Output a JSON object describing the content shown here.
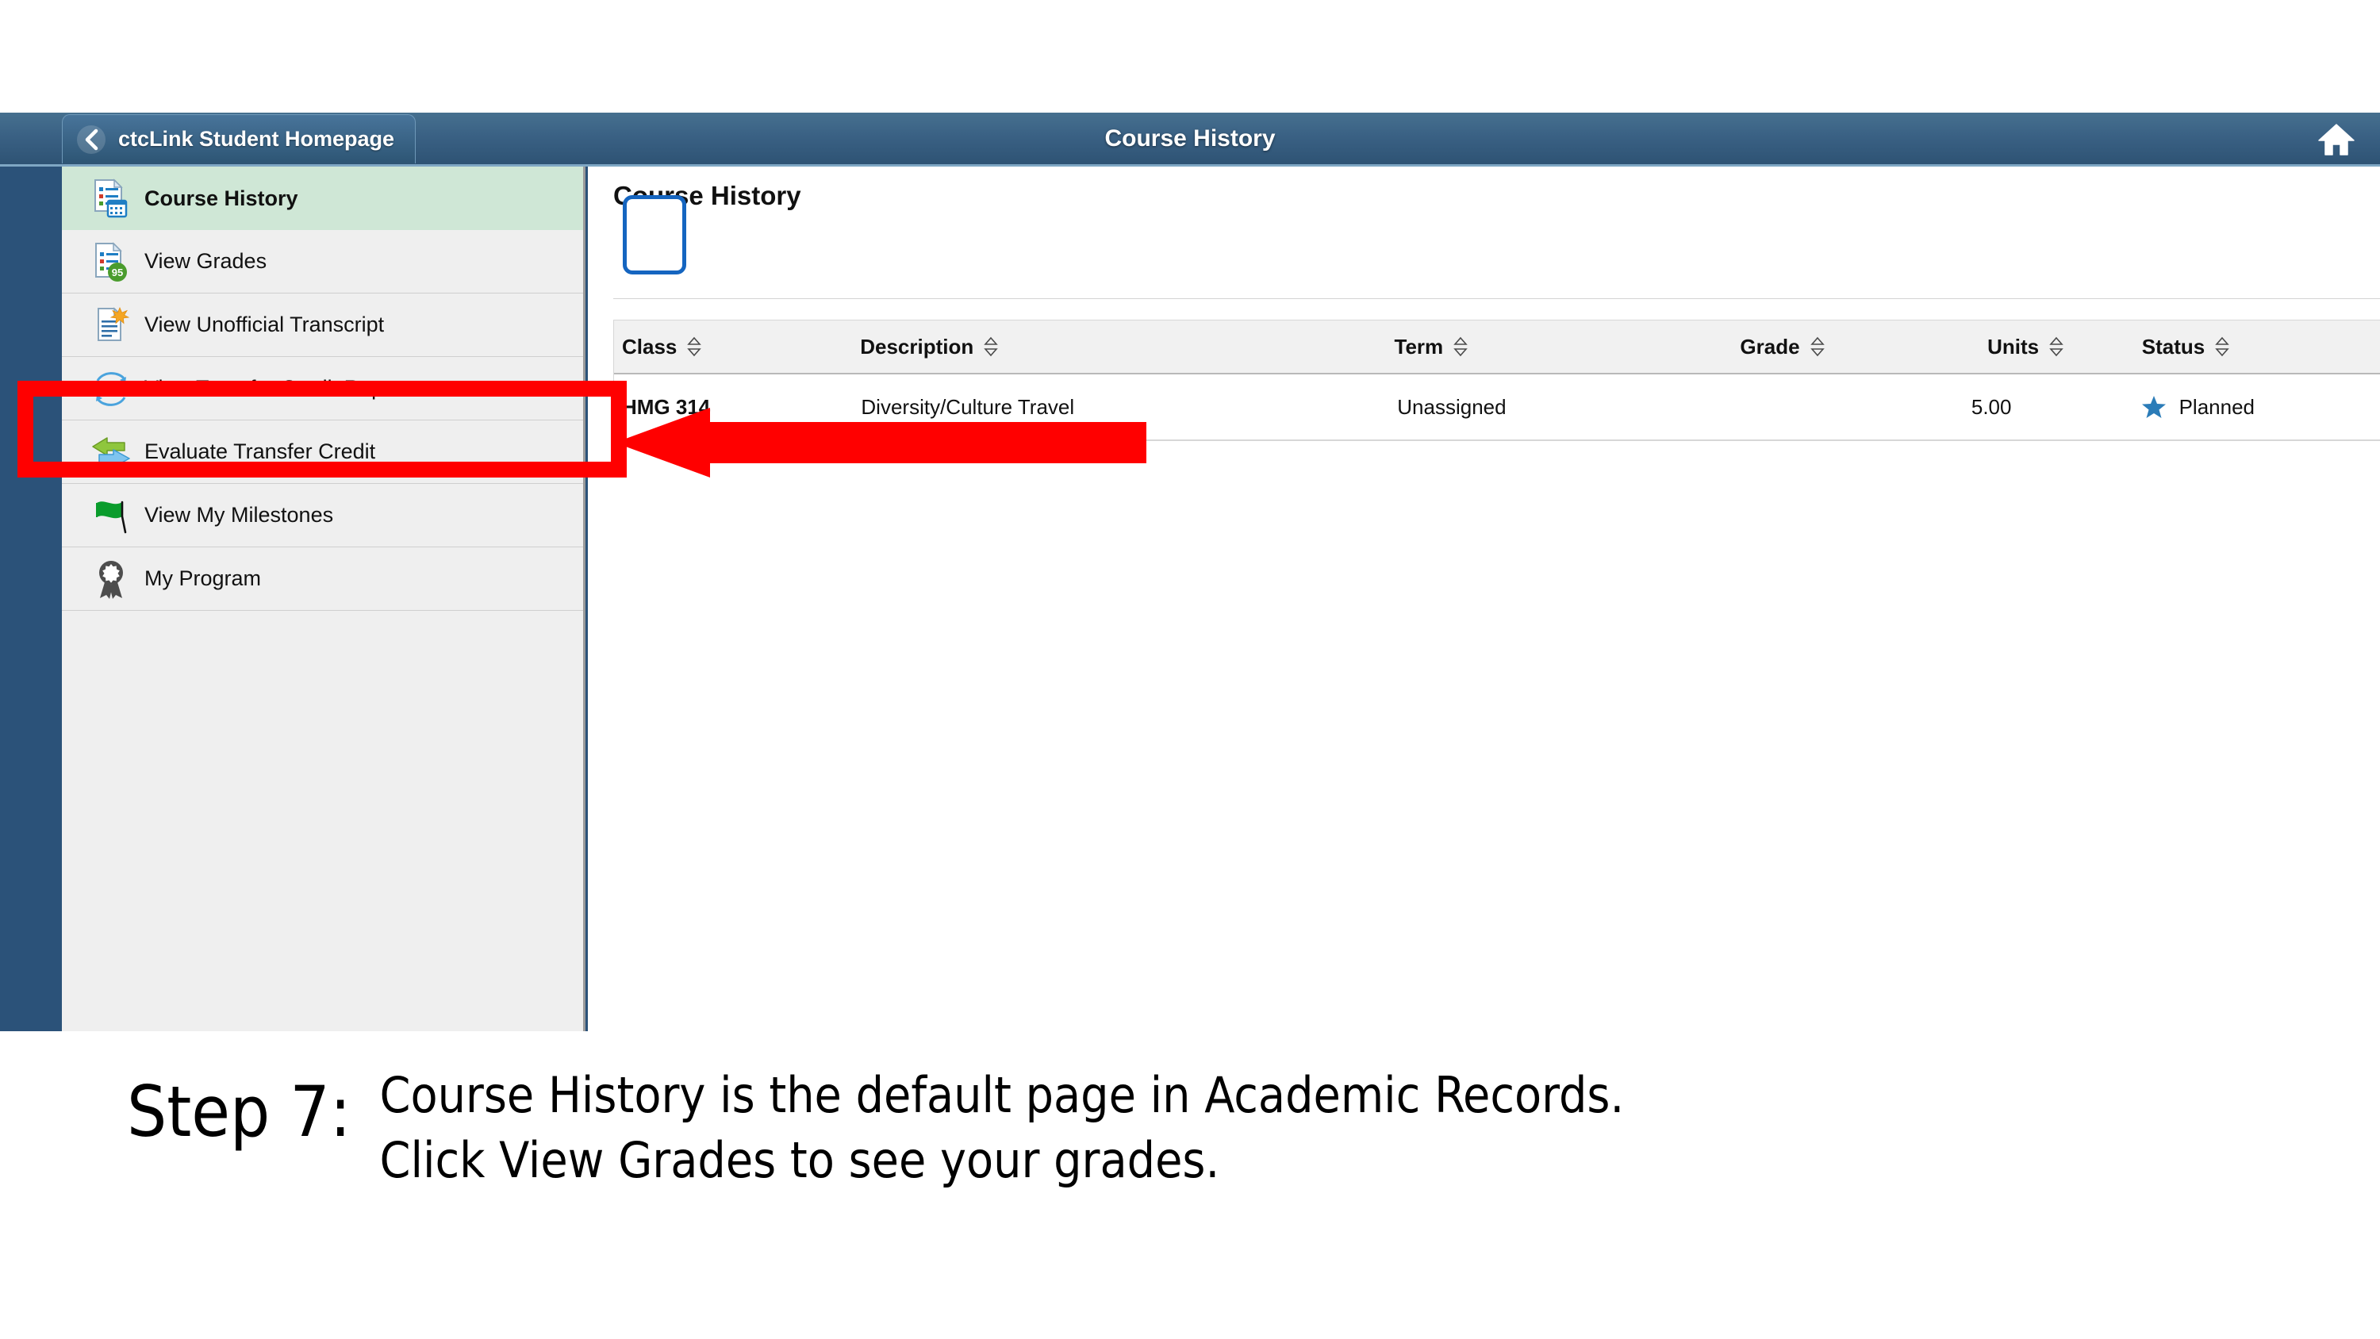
{
  "nav": {
    "back_label": "ctcLink Student Homepage",
    "back_icon": "chevron-left-icon",
    "title": "Course History",
    "home_icon": "home-icon"
  },
  "sidebar": {
    "items": [
      {
        "label": "Course History",
        "icon": "document-list-calendar-icon",
        "active": true,
        "badge": ""
      },
      {
        "label": "View Grades",
        "icon": "document-list-icon",
        "active": false,
        "badge": "95"
      },
      {
        "label": "View Unofficial Transcript",
        "icon": "document-star-icon",
        "active": false,
        "badge": ""
      },
      {
        "label": "View Transfer Credit Report",
        "icon": "transfer-credit-icon",
        "active": false,
        "badge": ""
      },
      {
        "label": "Evaluate Transfer Credit",
        "icon": "two-arrows-icon",
        "active": false,
        "badge": ""
      },
      {
        "label": "View My Milestones",
        "icon": "green-flag-icon",
        "active": false,
        "badge": ""
      },
      {
        "label": "My Program",
        "icon": "award-ribbon-icon",
        "active": false,
        "badge": ""
      }
    ]
  },
  "content": {
    "title": "Course History",
    "table": {
      "columns": [
        {
          "label": "Class",
          "sort_icon": "sort-updown-icon"
        },
        {
          "label": "Description",
          "sort_icon": "sort-updown-icon"
        },
        {
          "label": "Term",
          "sort_icon": "sort-updown-icon"
        },
        {
          "label": "Grade",
          "sort_icon": "sort-updown-icon"
        },
        {
          "label": "Units",
          "sort_icon": "sort-updown-icon"
        },
        {
          "label": "Status",
          "sort_icon": "sort-updown-icon"
        }
      ],
      "rows": [
        {
          "class": "HMG 314",
          "description": "Diversity/Culture Travel",
          "term": "Unassigned",
          "grade": "",
          "units": "5.00",
          "status": "Planned",
          "status_icon": "blue-star-icon"
        }
      ]
    }
  },
  "annotation": {
    "highlight_target": "View Grades",
    "highlight_color": "#ff0000",
    "arrow_color": "#ff0000"
  },
  "caption": {
    "step": "Step 7:",
    "line1": "Course History is the default page in Academic Records.",
    "line2": "Click View Grades to see your grades."
  },
  "colors": {
    "nav_bar": "#3a6184",
    "window_frame": "#2b5279",
    "sidebar_bg": "#efefef",
    "active_item": "#cfe7d6",
    "accent_blue": "#1565c0",
    "star_blue": "#2b7cb8",
    "badge_green": "#4a9c2d"
  }
}
